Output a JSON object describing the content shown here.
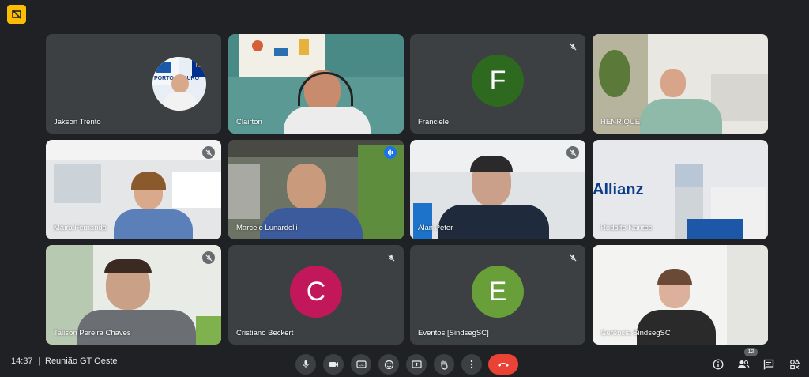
{
  "meeting": {
    "time": "14:37",
    "separator": "|",
    "title": "Reunião GT Oeste"
  },
  "participants": [
    {
      "name": "Jakson Trento"
    },
    {
      "name": "Clairton"
    },
    {
      "name": "Franciele",
      "initial": "F"
    },
    {
      "name": "HENRIQUE"
    },
    {
      "name": "Maira Fernanda"
    },
    {
      "name": "Marcelo Lunardelli"
    },
    {
      "name": "Alan Peter"
    },
    {
      "name": "Rodolfo Nantes"
    },
    {
      "name": "Talison Pereira Chaves"
    },
    {
      "name": "Cristiano Beckert",
      "initial": "C"
    },
    {
      "name": "Eventos [SindsegSC]",
      "initial": "E"
    },
    {
      "name": "Gerência SindsegSC"
    }
  ],
  "tile_texts": {
    "porto": "PORTO SEGURO",
    "itau": "Itaú",
    "allianz": "Allianz"
  },
  "people_count": "12",
  "colors": {
    "franciele": "#2d6a1f",
    "cristiano": "#c2185b",
    "eventos": "#689f38",
    "end_call": "#ea4335",
    "alert": "#fbbc04"
  }
}
